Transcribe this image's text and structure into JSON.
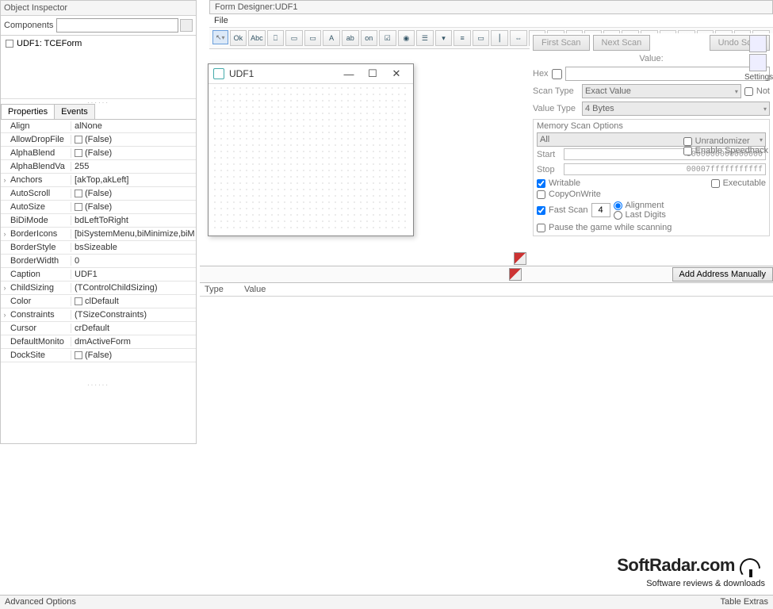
{
  "inspector": {
    "title": "Object Inspector",
    "components_label": "Components",
    "tree_item": "UDF1: TCEForm",
    "tabs": [
      "Properties",
      "Events"
    ],
    "props": [
      {
        "exp": "",
        "name": "Align",
        "val": "alNone",
        "cb": false
      },
      {
        "exp": "",
        "name": "AllowDropFile",
        "val": "(False)",
        "cb": true
      },
      {
        "exp": "",
        "name": "AlphaBlend",
        "val": "(False)",
        "cb": true
      },
      {
        "exp": "",
        "name": "AlphaBlendVa",
        "val": "255",
        "cb": false
      },
      {
        "exp": "›",
        "name": "Anchors",
        "val": "[akTop,akLeft]",
        "cb": false
      },
      {
        "exp": "",
        "name": "AutoScroll",
        "val": "(False)",
        "cb": true
      },
      {
        "exp": "",
        "name": "AutoSize",
        "val": "(False)",
        "cb": true
      },
      {
        "exp": "",
        "name": "BiDiMode",
        "val": "bdLeftToRight",
        "cb": false
      },
      {
        "exp": "›",
        "name": "BorderIcons",
        "val": "[biSystemMenu,biMinimize,biM",
        "cb": false
      },
      {
        "exp": "",
        "name": "BorderStyle",
        "val": "bsSizeable",
        "cb": false
      },
      {
        "exp": "",
        "name": "BorderWidth",
        "val": "0",
        "cb": false
      },
      {
        "exp": "",
        "name": "Caption",
        "val": "UDF1",
        "cb": false
      },
      {
        "exp": "›",
        "name": "ChildSizing",
        "val": "(TControlChildSizing)",
        "cb": false
      },
      {
        "exp": "",
        "name": "Color",
        "val": "clDefault",
        "cb": true
      },
      {
        "exp": "›",
        "name": "Constraints",
        "val": "(TSizeConstraints)",
        "cb": false
      },
      {
        "exp": "",
        "name": "Cursor",
        "val": "crDefault",
        "cb": false
      },
      {
        "exp": "",
        "name": "DefaultMonito",
        "val": "dmActiveForm",
        "cb": false
      },
      {
        "exp": "",
        "name": "DockSite",
        "val": "(False)",
        "cb": true
      }
    ]
  },
  "designer": {
    "title": "Form Designer:UDF1",
    "menu_file": "File",
    "tool_names": [
      "pointer",
      "ok",
      "abc",
      "label",
      "image",
      "panel",
      "label2",
      "ab",
      "on",
      "check",
      "radio",
      "list",
      "combo",
      "memo",
      "group",
      "splitter",
      "scroll",
      "link",
      "table",
      "pen",
      "cross",
      "date",
      "calendar1",
      "clock",
      "calendar2",
      "open",
      "save",
      "dialog",
      "color",
      "cursor"
    ]
  },
  "udf": {
    "title": "UDF1"
  },
  "ce": {
    "first_scan": "First Scan",
    "next_scan": "Next Scan",
    "undo_scan": "Undo Scan",
    "settings": "Settings",
    "value_label": "Value:",
    "hex": "Hex",
    "scan_type": "Scan Type",
    "scan_type_val": "Exact Value",
    "not": "Not",
    "value_type": "Value Type",
    "value_type_val": "4 Bytes",
    "mso": "Memory Scan Options",
    "mso_all": "All",
    "unrandomizer": "Unrandomizer",
    "speedhack": "Enable Speedhack",
    "start": "Start",
    "start_val": "0000000000000000",
    "stop": "Stop",
    "stop_val": "00007fffffffffff",
    "writable": "Writable",
    "executable": "Executable",
    "cow": "CopyOnWrite",
    "fastscan": "Fast Scan",
    "fastscan_val": "4",
    "alignment": "Alignment",
    "lastdigits": "Last Digits",
    "pause": "Pause the game while scanning",
    "add_manual": "Add Address Manually"
  },
  "results": {
    "type": "Type",
    "value": "Value"
  },
  "watermark": {
    "line1": "SoftRadar.com",
    "line2": "Software reviews & downloads"
  },
  "status": {
    "left": "Advanced Options",
    "right": "Table Extras"
  }
}
